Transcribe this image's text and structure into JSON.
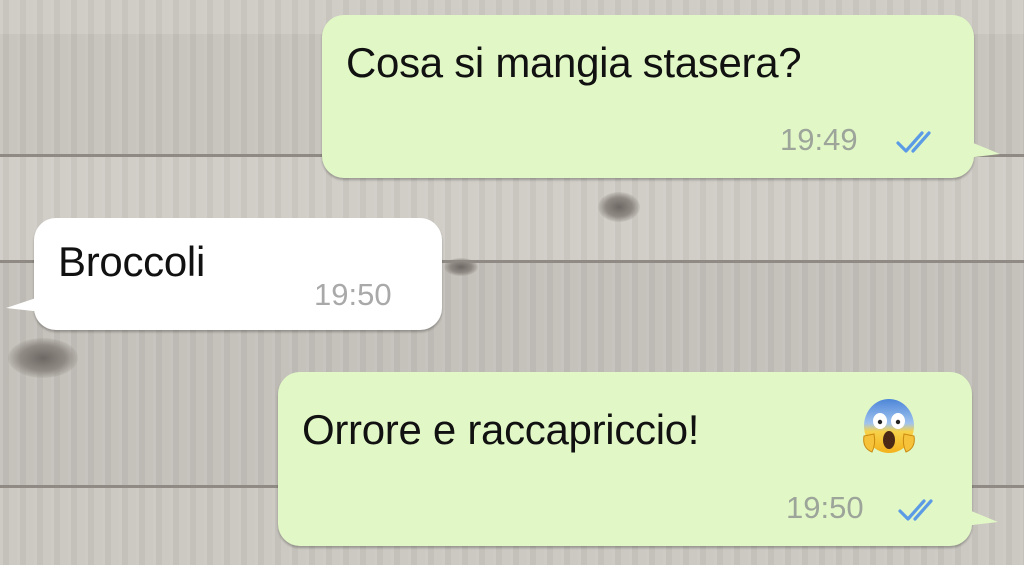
{
  "chat": {
    "messages": [
      {
        "direction": "outgoing",
        "text": "Cosa si mangia stasera?",
        "time": "19:49",
        "read_receipt": "double-check-icon",
        "status_color": "#5b9be6"
      },
      {
        "direction": "incoming",
        "text": "Broccoli",
        "time": "19:50"
      },
      {
        "direction": "outgoing",
        "text": "Orrore e raccapriccio!",
        "emoji": "face-screaming-in-fear-icon",
        "time": "19:50",
        "read_receipt": "double-check-icon",
        "status_color": "#5b9be6"
      }
    ]
  },
  "colors": {
    "outgoing_bubble": "#e1f8c6",
    "incoming_bubble": "#ffffff",
    "background": "#c9c5bf"
  }
}
